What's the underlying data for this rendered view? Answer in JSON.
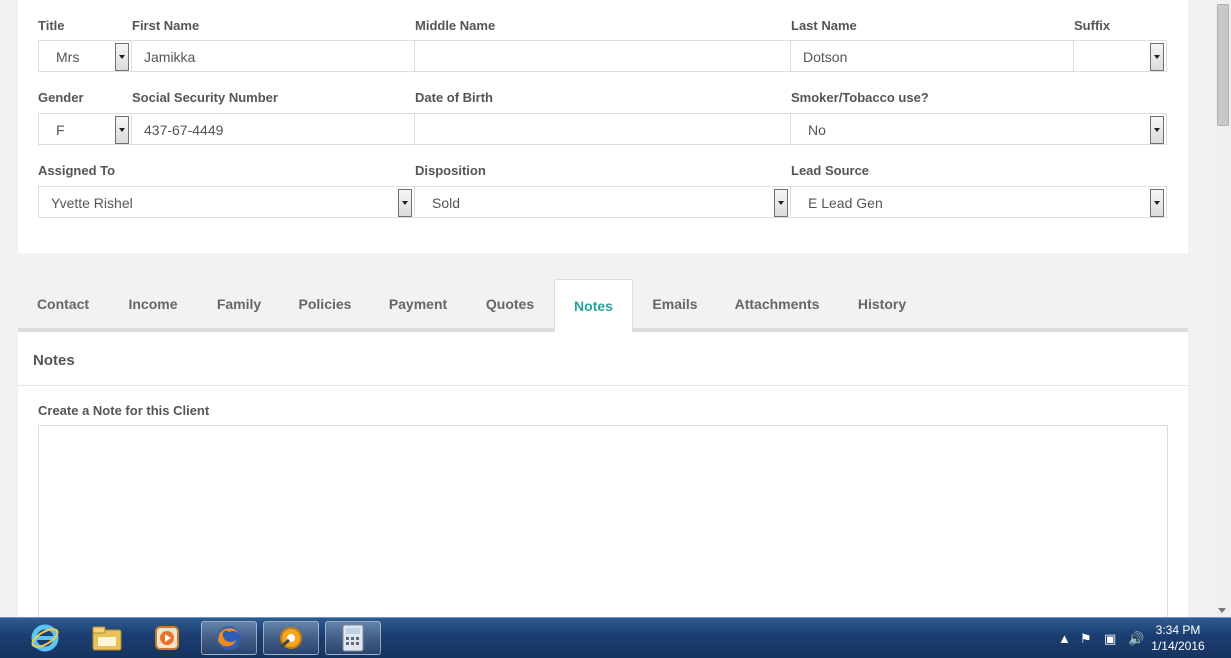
{
  "form": {
    "title": {
      "label": "Title",
      "value": "Mrs"
    },
    "first_name": {
      "label": "First Name",
      "value": "Jamikka"
    },
    "middle_name": {
      "label": "Middle Name",
      "value": ""
    },
    "last_name": {
      "label": "Last Name",
      "value": "Dotson"
    },
    "suffix": {
      "label": "Suffix",
      "value": ""
    },
    "gender": {
      "label": "Gender",
      "value": "F"
    },
    "ssn": {
      "label": "Social Security Number",
      "value": "437-67-4449"
    },
    "dob": {
      "label": "Date of Birth",
      "value": ""
    },
    "smoker": {
      "label": "Smoker/Tobacco use?",
      "value": "No"
    },
    "assigned_to": {
      "label": "Assigned To",
      "value": "Yvette Rishel"
    },
    "disposition": {
      "label": "Disposition",
      "value": "Sold"
    },
    "lead_source": {
      "label": "Lead Source",
      "value": "E Lead Gen"
    }
  },
  "tabs": [
    {
      "label": "Contact"
    },
    {
      "label": "Income"
    },
    {
      "label": "Family"
    },
    {
      "label": "Policies"
    },
    {
      "label": "Payment"
    },
    {
      "label": "Quotes"
    },
    {
      "label": "Notes",
      "active": true
    },
    {
      "label": "Emails"
    },
    {
      "label": "Attachments"
    },
    {
      "label": "History"
    }
  ],
  "notes": {
    "heading": "Notes",
    "create_label": "Create a Note for this Client",
    "textarea_value": ""
  },
  "taskbar": {
    "apps": [
      "internet-explorer-icon",
      "file-explorer-icon",
      "media-player-icon",
      "firefox-icon",
      "remote-support-icon",
      "calculator-icon"
    ],
    "time": "3:34 PM",
    "date": "1/14/2016"
  },
  "colors": {
    "accent": "#26a69a",
    "taskbar": "#1b3d70"
  }
}
